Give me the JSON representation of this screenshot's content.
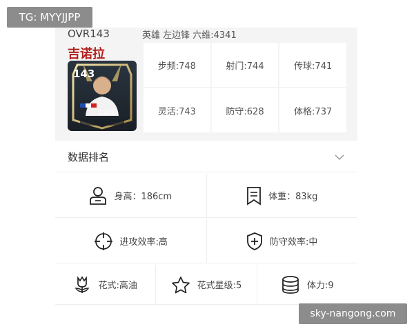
{
  "overlay": {
    "tg_label": "TG: MYYJJPP",
    "watermark": "sky-nangong.com"
  },
  "player": {
    "ovr": "OVR143",
    "position_line": "英雄 左边锋 六维:4341",
    "name": "吉诺拉",
    "card": {
      "rating": "143",
      "name": "吉诺拉"
    },
    "stats": [
      "步频:748",
      "射门:744",
      "传球:741",
      "灵活:743",
      "防守:628",
      "体格:737"
    ]
  },
  "ranking": {
    "title": "数据排名",
    "expand_icon": "chevron-down-icon"
  },
  "attributes": {
    "height": "身高：186cm",
    "weight": "体重：83kg",
    "attack_efficiency": "进攻效率:高",
    "defense_efficiency": "防守效率:中",
    "skill_style": "花式:高油",
    "skill_stars": "花式星级:5",
    "stamina": "体力:9"
  },
  "colors": {
    "name_red": "#b0201c",
    "overlay_gray": "#8c8c8c",
    "card_bg": "#f4f4f4"
  }
}
